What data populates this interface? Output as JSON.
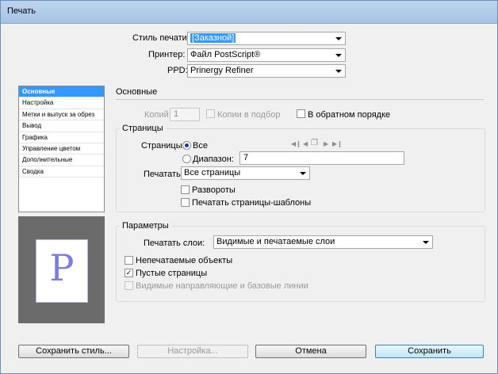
{
  "window": {
    "title": "Печать"
  },
  "top": {
    "style_label": "Стиль печати:",
    "style_value": "[Заказной]",
    "printer_label": "Принтер:",
    "printer_value": "Файл PostScript®",
    "ppd_label": "PPD:",
    "ppd_value": "Prinergy Refiner"
  },
  "sidebar": {
    "items": [
      {
        "label": "Основные",
        "selected": true
      },
      {
        "label": "Настройка"
      },
      {
        "label": "Метки и выпуск за обрез"
      },
      {
        "label": "Вывод"
      },
      {
        "label": "Графика"
      },
      {
        "label": "Управление цветом"
      },
      {
        "label": "Дополнительные"
      },
      {
        "label": "Сводка"
      }
    ]
  },
  "preview": {
    "letter": "P"
  },
  "main": {
    "section_title": "Основные",
    "copies_label": "Копий:",
    "copies_value": "1",
    "collate_label": "Копии в подбор",
    "reverse_label": "В обратном порядке",
    "pages": {
      "title": "Страницы",
      "pages_label": "Страницы:",
      "all_label": "Все",
      "range_label": "Диапазон:",
      "range_value": "7",
      "print_label": "Печатать:",
      "print_value": "Все страницы",
      "spreads_label": "Развороты",
      "master_label": "Печатать страницы-шаблоны"
    },
    "options": {
      "title": "Параметры",
      "layers_label": "Печатать слои:",
      "layers_value": "Видимые и печатаемые слои",
      "nonprinting_label": "Непечатаемые объекты",
      "blank_label": "Пустые страницы",
      "guides_label": "Видимые направляющие и базовые линии"
    }
  },
  "buttons": {
    "save_style": "Сохранить стиль...",
    "setup": "Настройка...",
    "cancel": "Отмена",
    "save": "Сохранить"
  }
}
